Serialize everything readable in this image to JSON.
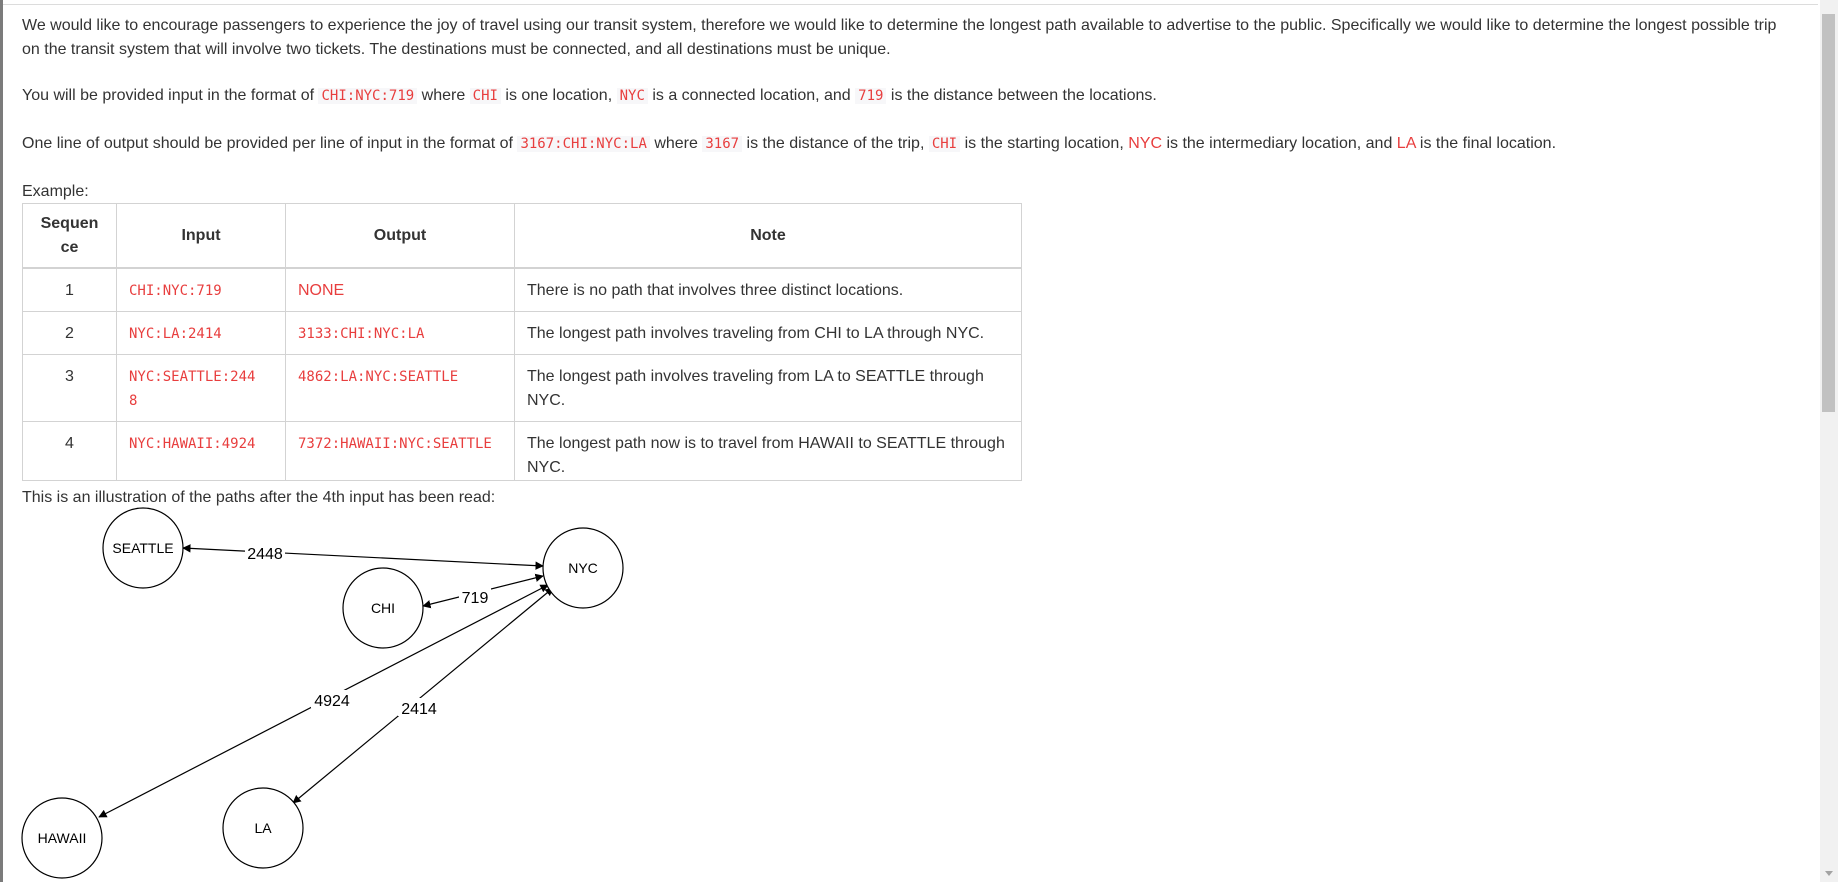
{
  "intro": {
    "paragraph1": "We would like to encourage passengers to experience the joy of travel using our transit system, therefore we would like to determine the longest path available to advertise to the public. Specifically we would like to determine the longest possible trip on the transit system that will involve two tickets. The destinations must be connected, and all destinations must be unique.",
    "p2_a": "You will be provided input in the format of ",
    "p2_code1": "CHI:NYC:719",
    "p2_b": " where ",
    "p2_code2": "CHI",
    "p2_c": " is one location, ",
    "p2_code3": "NYC",
    "p2_d": " is a connected location, and ",
    "p2_code4": "719",
    "p2_e": " is the distance between the locations.",
    "p3_a": "One line of output should be provided per line of input in the format of ",
    "p3_code1": "3167:CHI:NYC:LA",
    "p3_b": " where ",
    "p3_code2": "3167",
    "p3_c": " is the distance of the trip, ",
    "p3_code3": "CHI",
    "p3_d": " is the starting location, ",
    "p3_red1": "NYC",
    "p3_e": " is the intermediary location, and ",
    "p3_red2": "LA",
    "p3_f": " is the final location.",
    "example_label": "Example:"
  },
  "table": {
    "headers": [
      "Sequence",
      "Input",
      "Output",
      "Note"
    ],
    "rows": [
      {
        "seq": "1",
        "input": "CHI:NYC:719",
        "output": "NONE",
        "note": "There is no path that involves three distinct locations."
      },
      {
        "seq": "2",
        "input": "NYC:LA:2414",
        "output": "3133:CHI:NYC:LA",
        "note": "The longest path involves traveling from CHI to LA through NYC."
      },
      {
        "seq": "3",
        "input": "NYC:SEATTLE:2448",
        "output": "4862:LA:NYC:SEATTLE",
        "note": "The longest path involves traveling from LA to SEATTLE through NYC."
      },
      {
        "seq": "4",
        "input": "NYC:HAWAII:4924",
        "output": "7372:HAWAII:NYC:SEATTLE",
        "note": "The longest path now is to travel from HAWAII to SEATTLE through NYC."
      }
    ]
  },
  "illustration_caption": "This is an illustration of the paths after the 4th input has been read:",
  "diagram": {
    "nodes": [
      "SEATTLE",
      "NYC",
      "CHI",
      "HAWAII",
      "LA"
    ],
    "edges": [
      {
        "from": "SEATTLE",
        "to": "NYC",
        "label": "2448"
      },
      {
        "from": "CHI",
        "to": "NYC",
        "label": "719"
      },
      {
        "from": "HAWAII",
        "to": "NYC",
        "label": "4924"
      },
      {
        "from": "LA",
        "to": "NYC",
        "label": "2414"
      }
    ]
  },
  "colors": {
    "code": "#e83e3e",
    "text": "#333333",
    "border": "#d3d3d3"
  }
}
